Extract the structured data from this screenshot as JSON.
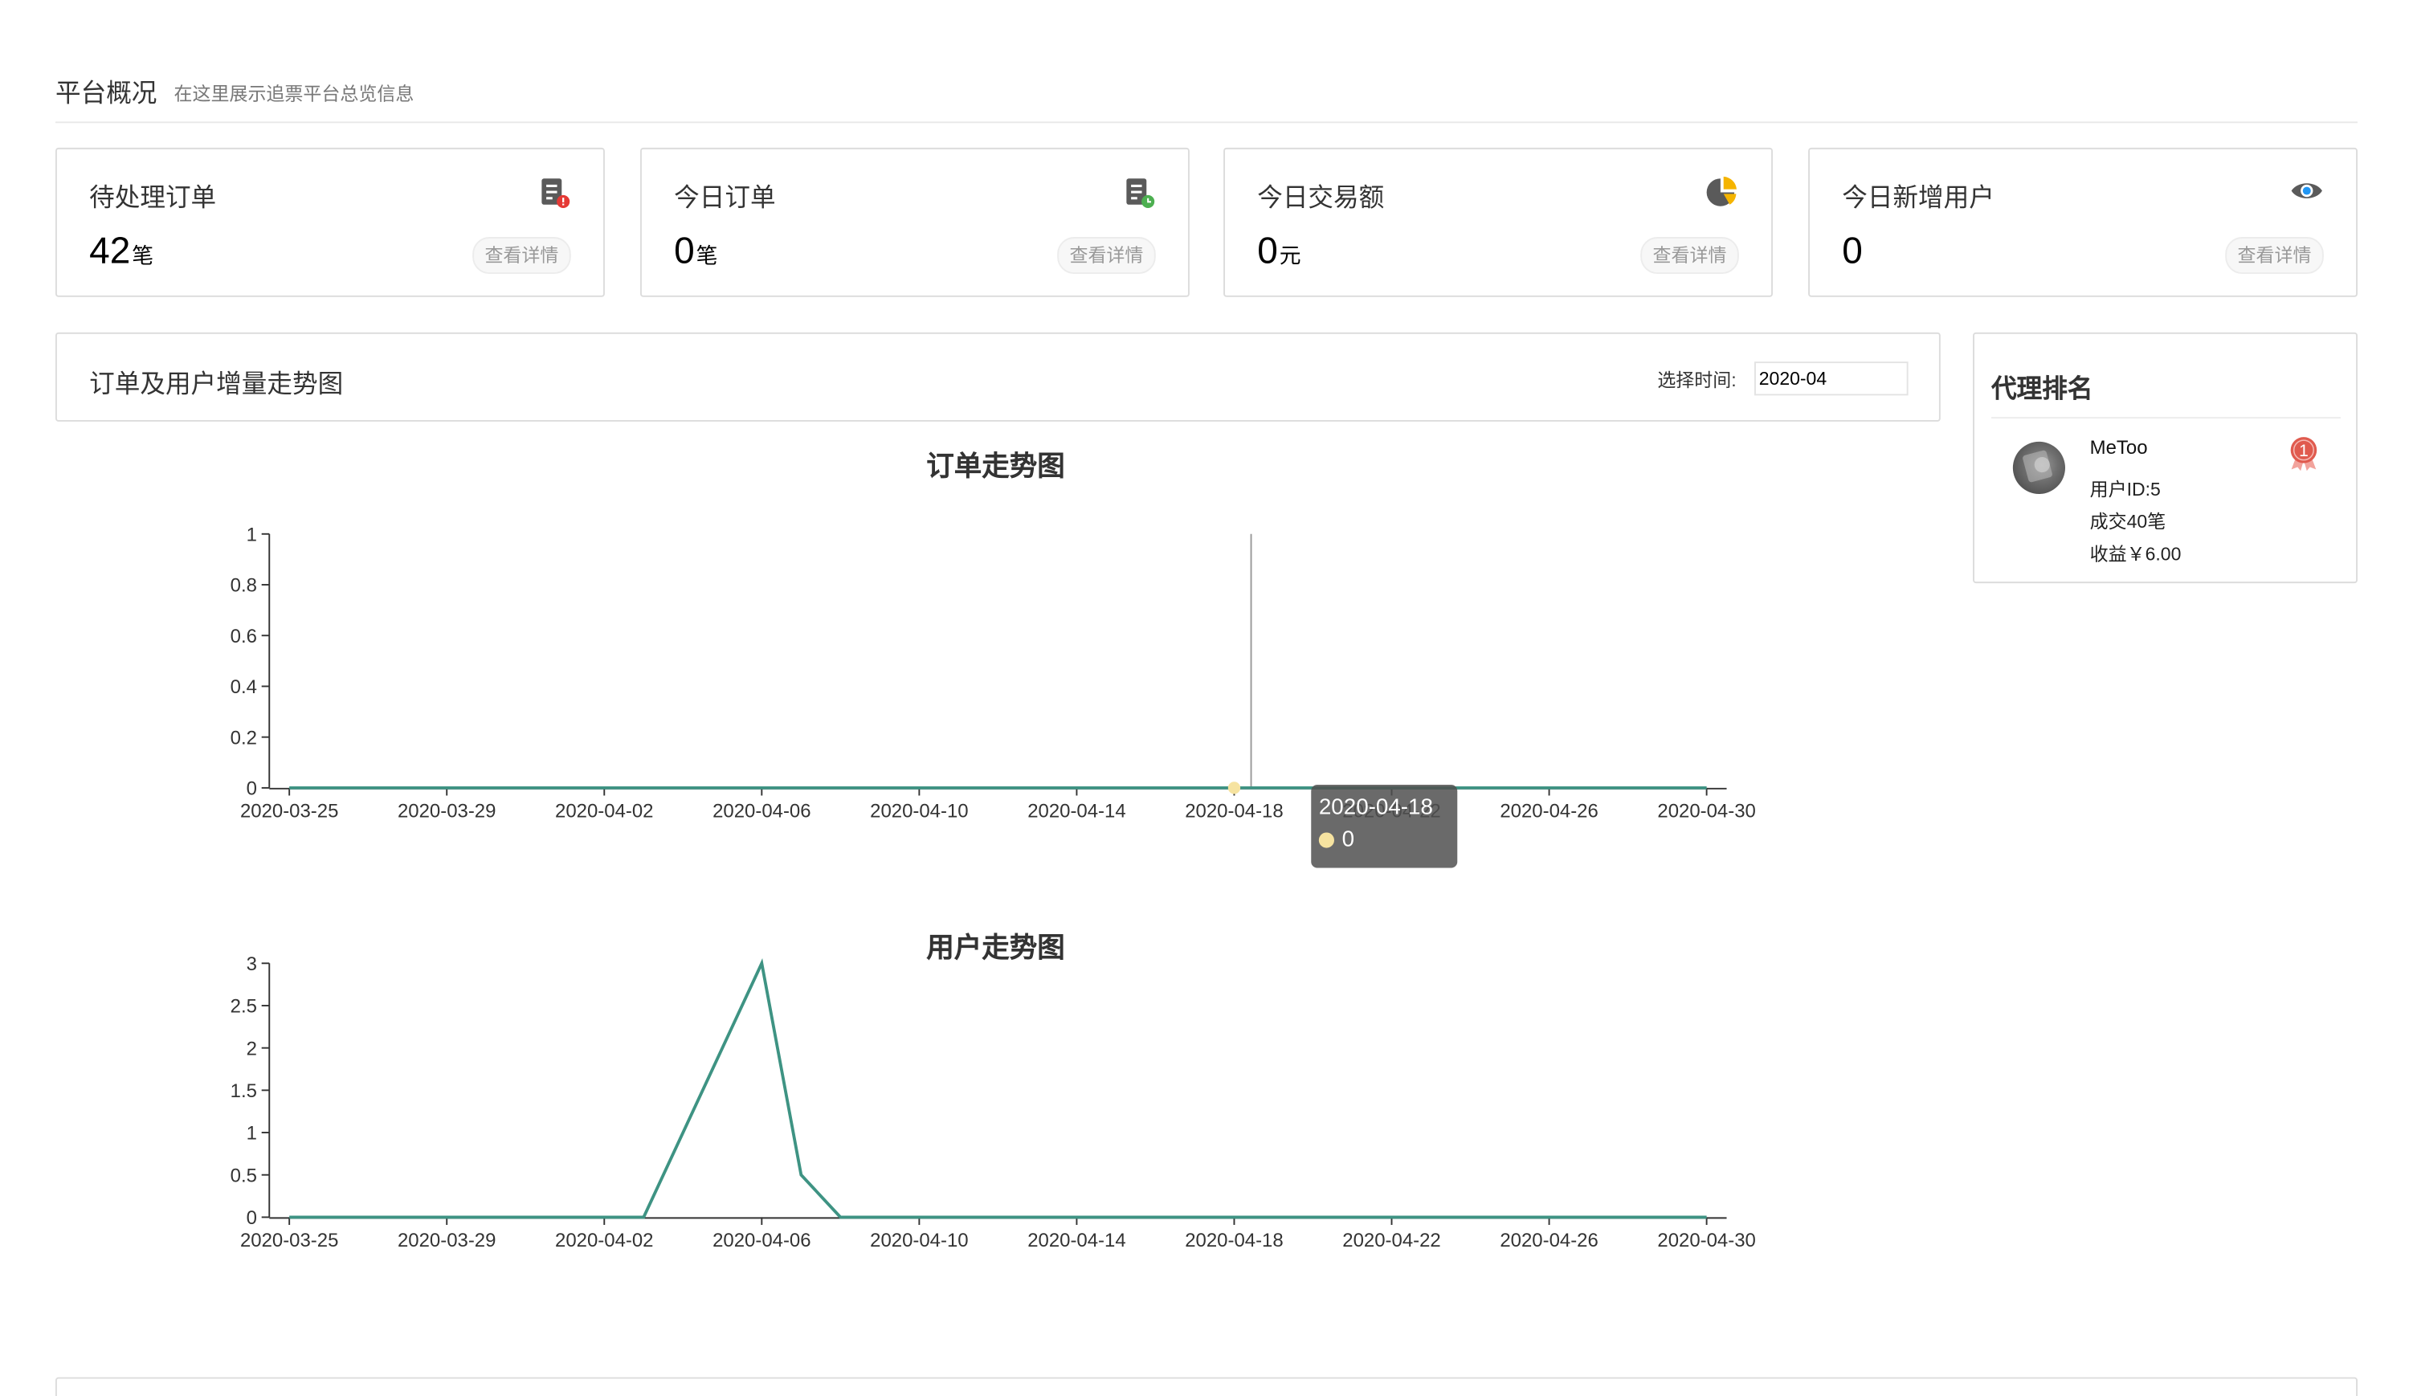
{
  "header": {
    "title": "平台概况",
    "subtitle": "在这里展示追票平台总览信息"
  },
  "stats": [
    {
      "title": "待处理订单",
      "value": "42",
      "unit": "笔",
      "link": "查看详情",
      "icon": "order-alert-icon",
      "icon_color": "#e53935"
    },
    {
      "title": "今日订单",
      "value": "0",
      "unit": "笔",
      "link": "查看详情",
      "icon": "order-time-icon",
      "icon_color": "#4caf50"
    },
    {
      "title": "今日交易额",
      "value": "0",
      "unit": "元",
      "link": "查看详情",
      "icon": "pie-chart-icon",
      "icon_color": "#f5b400"
    },
    {
      "title": "今日新增用户",
      "value": "0",
      "unit": "",
      "link": "查看详情",
      "icon": "eye-icon",
      "icon_color": "#2196f3"
    }
  ],
  "trend": {
    "title": "订单及用户增量走势图",
    "date_label": "选择时间:",
    "date_value": "2020-04"
  },
  "ranking": {
    "title": "代理排名",
    "items": [
      {
        "rank": "1",
        "name": "MeToo",
        "user_id": "用户ID:5",
        "deals": "成交40笔",
        "income": "收益￥6.00",
        "medal_color": "#e05a4e"
      }
    ]
  },
  "chart_data": [
    {
      "type": "line",
      "title": "订单走势图",
      "x_ticks": [
        "2020-03-25",
        "2020-03-29",
        "2020-04-02",
        "2020-04-06",
        "2020-04-10",
        "2020-04-14",
        "2020-04-18",
        "2020-04-22",
        "2020-04-26",
        "2020-04-30"
      ],
      "y_ticks": [
        "0",
        "0.2",
        "0.4",
        "0.6",
        "0.8",
        "1"
      ],
      "ylim": [
        0,
        1
      ],
      "x_start": "2020-03-25",
      "x_end": "2020-04-30",
      "values": [
        0,
        0,
        0,
        0,
        0,
        0,
        0,
        0,
        0,
        0,
        0,
        0,
        0,
        0,
        0,
        0,
        0,
        0,
        0,
        0,
        0,
        0,
        0,
        0,
        0,
        0,
        0,
        0,
        0,
        0,
        0,
        0,
        0,
        0,
        0,
        0,
        0
      ],
      "line_color": "#3e9383",
      "tooltip": {
        "date": "2020-04-18",
        "value": "0",
        "dot_color": "#f6e3a0"
      }
    },
    {
      "type": "line",
      "title": "用户走势图",
      "x_ticks": [
        "2020-03-25",
        "2020-03-29",
        "2020-04-02",
        "2020-04-06",
        "2020-04-10",
        "2020-04-14",
        "2020-04-18",
        "2020-04-22",
        "2020-04-26",
        "2020-04-30"
      ],
      "y_ticks": [
        "0",
        "0.5",
        "1",
        "1.5",
        "2",
        "2.5",
        "3"
      ],
      "ylim": [
        0,
        3
      ],
      "x_start": "2020-03-25",
      "x_end": "2020-04-30",
      "values": [
        0,
        0,
        0,
        0,
        0,
        0,
        0,
        0,
        0,
        0,
        1,
        2,
        3,
        0.5,
        0,
        0,
        0,
        0,
        0,
        0,
        0,
        0,
        0,
        0,
        0,
        0,
        0,
        0,
        0,
        0,
        0,
        0,
        0,
        0,
        0,
        0,
        0
      ],
      "line_color": "#3e9383"
    }
  ]
}
